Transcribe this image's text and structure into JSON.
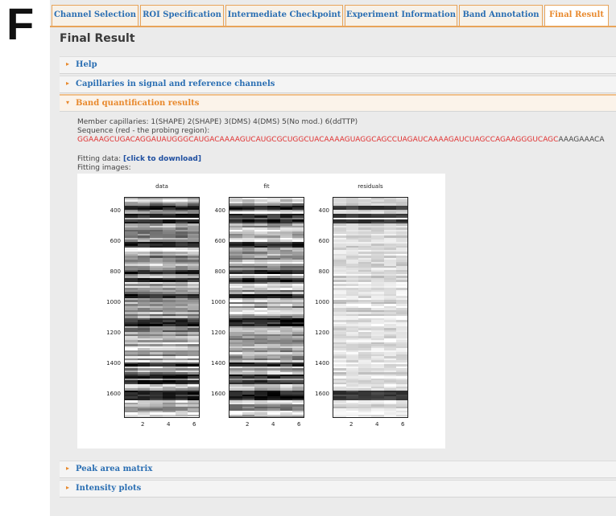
{
  "figure_label": "F",
  "tabs": [
    {
      "label": "Channel Selection",
      "active": false
    },
    {
      "label": "ROI Specification",
      "active": false
    },
    {
      "label": "Intermediate Checkpoint",
      "active": false
    },
    {
      "label": "Experiment Information",
      "active": false
    },
    {
      "label": "Band Annotation",
      "active": false
    },
    {
      "label": "Final Result",
      "active": true
    }
  ],
  "page_title": "Final Result",
  "sections": {
    "help": "Help",
    "capillaries": "Capillaries in signal and reference channels",
    "band_quant": "Band quantification results",
    "peak_area": "Peak area matrix",
    "intensity": "Intensity plots"
  },
  "results": {
    "member_capillaries": "Member capillaries: 1(SHAPE) 2(SHAPE) 3(DMS) 4(DMS) 5(No mod.) 6(ddTTP)",
    "sequence_label": "Sequence (red - the probing region):",
    "sequence_probing": "GGAAAGCUGACAGGAUAUGGGCAUGACAAAAGUCAUGCGCUGGCUACAAAAGUAGGCAGCCUAGAUCAAAAGAUCUAGCCAGAAGGGUCAGC",
    "sequence_rest": "AAAGAAACA",
    "fitting_data_label": "Fitting data:",
    "fitting_data_link": "[click to download]",
    "fitting_images_label": "Fitting images:"
  },
  "plots": {
    "titles": [
      "data",
      "fit",
      "residuals"
    ],
    "y_ticks": [
      "400",
      "600",
      "800",
      "1000",
      "1200",
      "1400",
      "1600"
    ],
    "x_ticks": [
      "2",
      "4",
      "6"
    ]
  },
  "colors": {
    "tab_border": "#e8a45a",
    "active_text": "#e8892d",
    "link_text": "#2b6fb3",
    "sequence_red": "#e03030"
  }
}
